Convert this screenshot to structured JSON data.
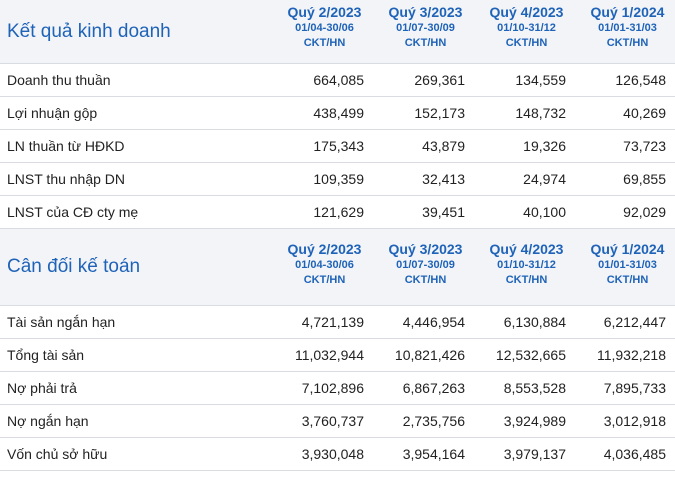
{
  "kqkd": {
    "title": "Kết quả kinh doanh",
    "periods": [
      {
        "quarter": "Quý 2/2023",
        "range": "01/04-30/06",
        "unit": "CKT/HN"
      },
      {
        "quarter": "Quý 3/2023",
        "range": "01/07-30/09",
        "unit": "CKT/HN"
      },
      {
        "quarter": "Quý 4/2023",
        "range": "01/10-31/12",
        "unit": "CKT/HN"
      },
      {
        "quarter": "Quý 1/2024",
        "range": "01/01-31/03",
        "unit": "CKT/HN"
      }
    ],
    "rows": [
      {
        "label": "Doanh thu thuần",
        "values": [
          "664,085",
          "269,361",
          "134,559",
          "126,548"
        ]
      },
      {
        "label": "Lợi nhuận gộp",
        "values": [
          "438,499",
          "152,173",
          "148,732",
          "40,269"
        ]
      },
      {
        "label": "LN thuần từ HĐKD",
        "values": [
          "175,343",
          "43,879",
          "19,326",
          "73,723"
        ]
      },
      {
        "label": "LNST thu nhập DN",
        "values": [
          "109,359",
          "32,413",
          "24,974",
          "69,855"
        ]
      },
      {
        "label": "LNST của CĐ cty mẹ",
        "values": [
          "121,629",
          "39,451",
          "40,100",
          "92,029"
        ]
      }
    ]
  },
  "cdkt": {
    "title": "Cân đối kế toán",
    "periods": [
      {
        "quarter": "Quý 2/2023",
        "range": "01/04-30/06",
        "unit": "CKT/HN"
      },
      {
        "quarter": "Quý 3/2023",
        "range": "01/07-30/09",
        "unit": "CKT/HN"
      },
      {
        "quarter": "Quý 4/2023",
        "range": "01/10-31/12",
        "unit": "CKT/HN"
      },
      {
        "quarter": "Quý 1/2024",
        "range": "01/01-31/03",
        "unit": "CKT/HN"
      }
    ],
    "rows": [
      {
        "label": "Tài sản ngắn hạn",
        "values": [
          "4,721,139",
          "4,446,954",
          "6,130,884",
          "6,212,447"
        ]
      },
      {
        "label": "Tổng tài sản",
        "values": [
          "11,032,944",
          "10,821,426",
          "12,532,665",
          "11,932,218"
        ]
      },
      {
        "label": "Nợ phải trả",
        "values": [
          "7,102,896",
          "6,867,263",
          "8,553,528",
          "7,895,733"
        ]
      },
      {
        "label": "Nợ ngắn hạn",
        "values": [
          "3,760,737",
          "2,735,756",
          "3,924,989",
          "3,012,918"
        ]
      },
      {
        "label": "Vốn chủ sở hữu",
        "values": [
          "3,930,048",
          "3,954,164",
          "3,979,137",
          "4,036,485"
        ]
      }
    ]
  }
}
